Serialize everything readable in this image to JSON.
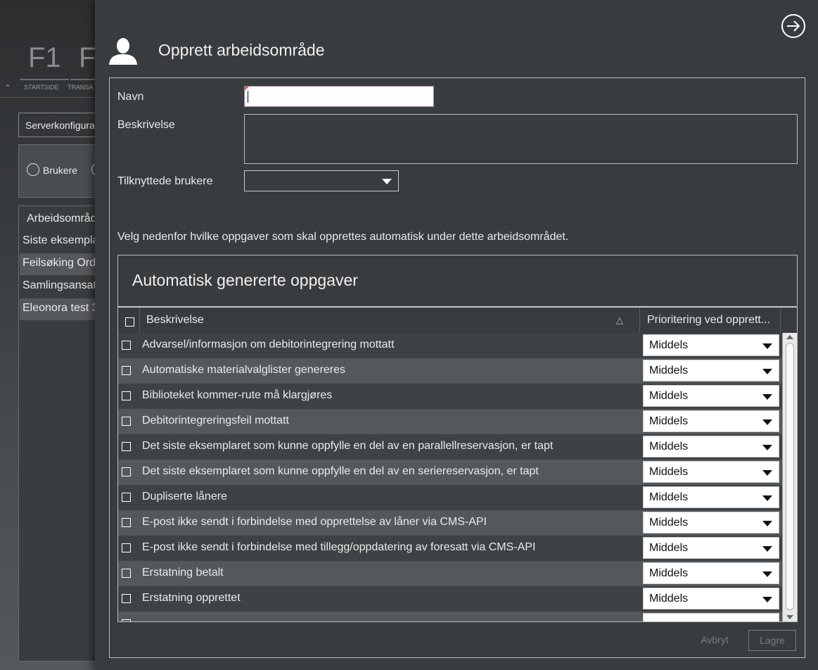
{
  "background_app": {
    "fkeys": [
      "F1",
      "F"
    ],
    "fkey_labels": [
      "STARTSIDE",
      "TRANSA"
    ],
    "server_select": "Serverkonfigura",
    "radio_label": "Brukere",
    "list_header": "Arbeidsområd",
    "list_items": [
      "Siste eksempla",
      "Feilsøking Ord",
      "Samlingsansat",
      "Eleonora test 3"
    ]
  },
  "dialog": {
    "title": "Opprett arbeidsområde",
    "labels": {
      "name": "Navn",
      "description": "Beskrivelse",
      "linked_users": "Tilknyttede brukere"
    },
    "fields": {
      "name_value": "",
      "description_value": "",
      "linked_users_value": ""
    },
    "info_text": "Velg nedenfor hvilke oppgaver som skal opprettes automatisk under dette arbeidsområdet.",
    "tasks_title": "Automatisk genererte oppgaver",
    "grid": {
      "col_description": "Beskrivelse",
      "col_priority": "Prioritering ved opprett...",
      "rows": [
        {
          "description": "Advarsel/informasjon om debitorintegrering mottatt",
          "priority": "Middels"
        },
        {
          "description": "Automatiske materialvalglister genereres",
          "priority": "Middels"
        },
        {
          "description": "Biblioteket kommer-rute må klargjøres",
          "priority": "Middels"
        },
        {
          "description": "Debitorintegreringsfeil mottatt",
          "priority": "Middels"
        },
        {
          "description": "Det siste eksemplaret som kunne oppfylle en del av en parallellreservasjon, er tapt",
          "priority": "Middels"
        },
        {
          "description": "Det siste eksemplaret som kunne oppfylle en del av en seriereservasjon, er tapt",
          "priority": "Middels"
        },
        {
          "description": "Dupliserte lånere",
          "priority": "Middels"
        },
        {
          "description": "E-post ikke sendt i forbindelse med opprettelse av låner via CMS-API",
          "priority": "Middels"
        },
        {
          "description": "E-post ikke sendt i forbindelse med tillegg/oppdatering av foresatt via CMS-API",
          "priority": "Middels"
        },
        {
          "description": "Erstatning betalt",
          "priority": "Middels"
        },
        {
          "description": "Erstatning opprettet",
          "priority": "Middels"
        },
        {
          "description": "",
          "priority": ""
        }
      ]
    },
    "buttons": {
      "cancel": "Avbryt",
      "save": "Lagre"
    }
  }
}
